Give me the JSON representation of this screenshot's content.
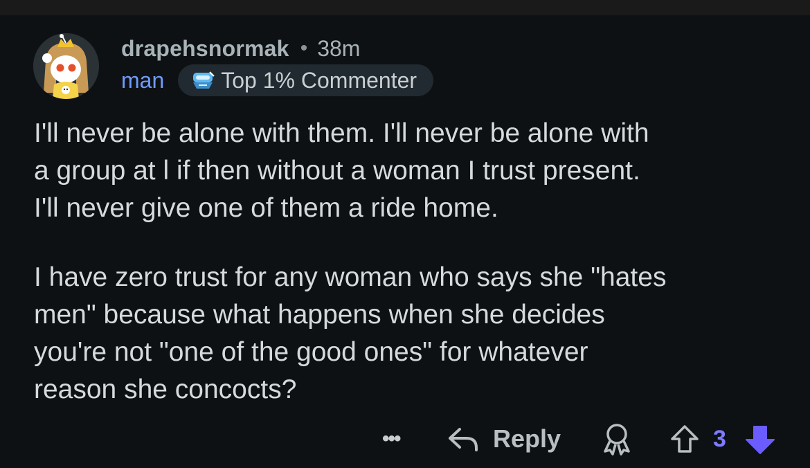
{
  "comment": {
    "username": "drapehsnormak",
    "separator": "•",
    "timestamp": "38m",
    "user_flair": "man",
    "badge_label": "Top 1% Commenter",
    "badge_icon": "commenter-badge-icon",
    "paragraphs": [
      "I'll never be alone with them. I'll never be alone with\na group at l if then without a woman I trust present.\nI'll never give one of them a ride home.",
      "I have zero trust for any woman who says she \"hates\nmen\" because what happens when she decides\nyou're not \"one of the good ones\" for whatever\nreason she concocts?"
    ]
  },
  "actions": {
    "more_label": "•••",
    "reply_label": "Reply",
    "vote_count": "3",
    "vote_state": "downvoted"
  },
  "colors": {
    "background": "#0e1113",
    "text": "#d7dadc",
    "username": "#a8b3b9",
    "flair": "#6f9bff",
    "badge_bg": "#212a30",
    "vote_accent": "#7d7cff",
    "downvote": "#6a5cff"
  }
}
